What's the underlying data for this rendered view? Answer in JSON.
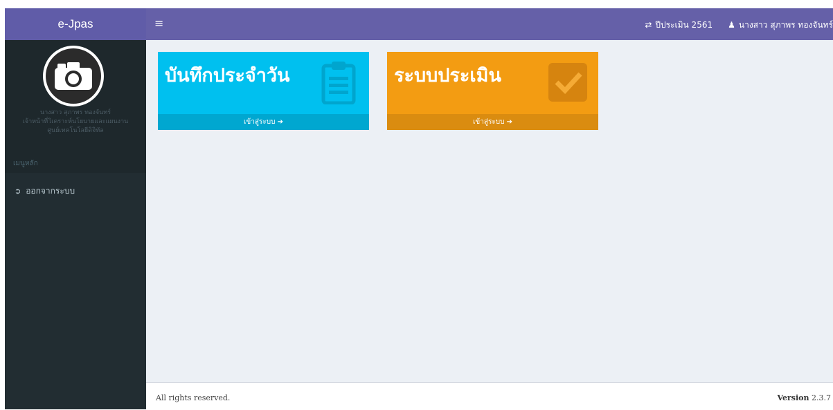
{
  "brand": {
    "name": "e-Jpas"
  },
  "topbar": {
    "menu_toggle": "≡",
    "year_icon": "⇄",
    "year_label": "ปีประเมิน 2561",
    "user_icon": "👤",
    "user_name": "นางสาว สุภาพร ทองจันทร์"
  },
  "sidebar": {
    "user_name": "นางสาว สุภาพร ทองจันทร์",
    "user_position": "เจ้าหน้าที่วิเคราะห์นโยบายและแผนงาน",
    "user_unit": "ศูนย์เทคโนโลยีดิจิทัล",
    "menu_header": "เมนูหลัก",
    "items": [
      {
        "label": "ออกจากระบบ",
        "icon": "sign-out-icon"
      }
    ]
  },
  "boxes": [
    {
      "title": "บันทึกประจำวัน",
      "footer": "เข้าสู่ระบบ ➔",
      "icon": "clipboard-icon",
      "color": "#00c0ef"
    },
    {
      "title": "ระบบประเมิน",
      "footer": "เข้าสู่ระบบ ➔",
      "icon": "checkbox-icon",
      "color": "#f39c12"
    }
  ],
  "footer": {
    "copyright": "All rights reserved.",
    "version_label": "Version",
    "version_number": "2.3.7"
  }
}
